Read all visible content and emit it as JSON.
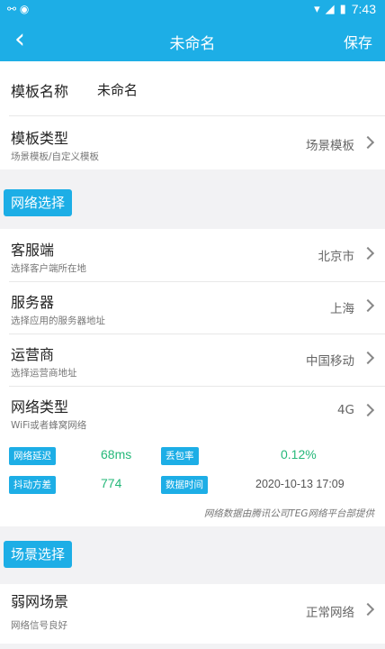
{
  "status_bar": {
    "time": "7:43"
  },
  "app_bar": {
    "back_icon": "chevron-left-icon",
    "title": "未命名",
    "save_label": "保存"
  },
  "template_name": {
    "label": "模板名称",
    "value": "未命名"
  },
  "template_type": {
    "label": "模板类型",
    "sub": "场景模板/自定义模板",
    "value": "场景模板"
  },
  "network_section": {
    "label": "网络选择"
  },
  "client": {
    "label": "客服端",
    "sub": "选择客户端所在地",
    "value": "北京市"
  },
  "server": {
    "label": "服务器",
    "sub": "选择应用的服务器地址",
    "value": "上海"
  },
  "carrier": {
    "label": "运营商",
    "sub": "选择运营商地址",
    "value": "中国移动"
  },
  "network_type": {
    "label": "网络类型",
    "sub": "WiFi或者蜂窝网络",
    "value": "4G"
  },
  "stats": {
    "latency_label": "网络延迟",
    "latency_value": "68ms",
    "loss_label": "丢包率",
    "loss_value": "0.12%",
    "jitter_label": "抖动方差",
    "jitter_value": "774",
    "data_time_label": "数据时间",
    "data_time_value": "2020-10-13 17:09"
  },
  "footnote": "网络数据由腾讯公司TEG网络平台部提供",
  "scene_section": {
    "label": "场景选择"
  },
  "weak_network": {
    "label": "弱网场景",
    "sub": "网络信号良好",
    "value": "正常网络"
  },
  "colors": {
    "accent": "#1daee6",
    "success": "#26b87a"
  }
}
